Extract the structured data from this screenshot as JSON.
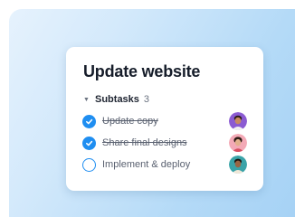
{
  "card": {
    "title": "Update website",
    "subtasks_label": "Subtasks",
    "subtasks_count": "3"
  },
  "tasks": [
    {
      "label": "Update copy",
      "done": true,
      "avatar": "avatar-man-purple-bg"
    },
    {
      "label": "Share final designs",
      "done": true,
      "avatar": "avatar-woman-pink-bg"
    },
    {
      "label": "Implement & deploy",
      "done": false,
      "avatar": "avatar-man-teal-bg"
    }
  ],
  "colors": {
    "accent": "#1f8ef1",
    "background_gradient_start": "#e6f2fd",
    "background_gradient_end": "#a6d2f5"
  }
}
